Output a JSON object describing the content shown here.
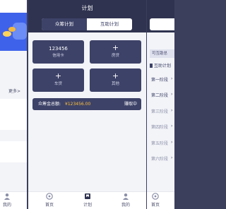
{
  "left_panel": {
    "more_label": "更多>",
    "tabs": [
      {
        "label": "我的",
        "icon": "person-icon"
      },
      {
        "label": "首页",
        "icon": "home-icon"
      }
    ]
  },
  "center_panel": {
    "title": "计划",
    "segments": [
      {
        "label": "众筹计划",
        "active": true
      },
      {
        "label": "互助计划",
        "active": false
      }
    ],
    "tiles": [
      {
        "value": "123456",
        "label": "信用卡"
      },
      {
        "value": "+",
        "label": "房贷"
      },
      {
        "value": "+",
        "label": "车贷"
      },
      {
        "value": "+",
        "label": "其他"
      }
    ],
    "amount": {
      "label": "众筹金总额:",
      "value": "¥123456.00",
      "status": "赚取中"
    },
    "tabs": [
      {
        "label": "首页",
        "icon": "home-icon"
      },
      {
        "label": "计划",
        "icon": "plan-icon"
      },
      {
        "label": "我的",
        "icon": "person-icon"
      }
    ]
  },
  "right_panel": {
    "filter_label": "可互助总",
    "section_title": "互助计划",
    "stages": [
      "第一阶段",
      "第二阶段",
      "第三阶段",
      "第四阶段",
      "第五阶段",
      "第六阶段"
    ]
  },
  "colors": {
    "navy": "#2f3350",
    "tile": "#3d4268",
    "accent_gold": "#ffc23d",
    "hero_blue": "#3f62ea"
  }
}
